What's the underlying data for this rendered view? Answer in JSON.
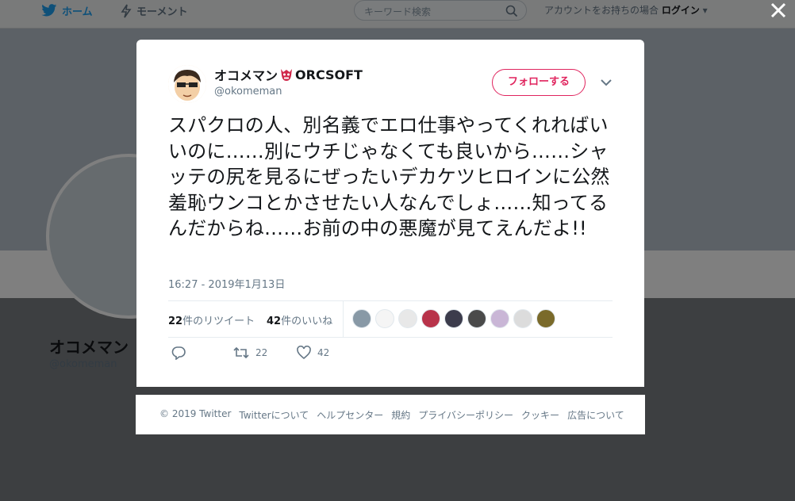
{
  "topnav": {
    "home_label": "ホーム",
    "moments_label": "モーメント",
    "search_placeholder": "キーワード検索",
    "login_prompt": "アカウントをお持ちの場合",
    "login_label": "ログイン"
  },
  "profile_bg": {
    "name": "オコメマン",
    "handle": "@okomeman"
  },
  "tweet": {
    "author_name": "オコメマン",
    "author_name_suffix": "ORCSOFT",
    "author_handle": "@okomeman",
    "follow_label": "フォローする",
    "text": "スパクロの人、別名義でエロ仕事やってくれればいいのに……別にウチじゃなくても良いから……シャッテの尻を見るにぜったいデカケツヒロインに公然羞恥ウンコとかさせたい人なんでしょ……知ってるんだからね……お前の中の悪魔が見てえんだよ!!",
    "timestamp": "16:27 - 2019年1月13日",
    "retweets": {
      "count": "22",
      "label": "件のリツイート"
    },
    "likes": {
      "count": "42",
      "label": "件のいいね"
    },
    "action_retweet_count": "22",
    "action_like_count": "42",
    "liker_colors": [
      "#8899a6",
      "#f5f5f5",
      "#e8e8e8",
      "#b8334a",
      "#3c3c4c",
      "#4a4a4a",
      "#c9b6d6",
      "#dcdcdc",
      "#7a6a2a"
    ]
  },
  "footer": {
    "links": [
      "© 2019 Twitter",
      "Twitterについて",
      "ヘルプセンター",
      "規約",
      "プライバシーポリシー",
      "クッキー",
      "広告について"
    ]
  },
  "colors": {
    "accent": "#1da1f2",
    "follow": "#e0245e"
  }
}
